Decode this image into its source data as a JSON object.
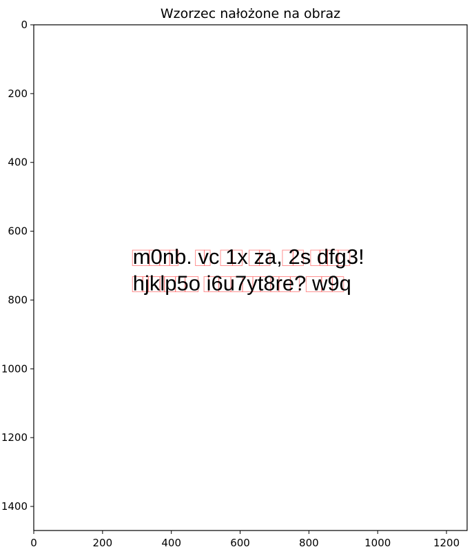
{
  "chart_data": {
    "type": "other",
    "title": "Wzorzec nałożone na obraz",
    "xlabel": "",
    "ylabel": "",
    "xlim": [
      0,
      1260
    ],
    "ylim": [
      1470,
      0
    ],
    "x_ticks": [
      0,
      200,
      400,
      600,
      800,
      1000,
      1200
    ],
    "y_ticks": [
      0,
      200,
      400,
      600,
      800,
      1000,
      1200,
      1400
    ],
    "grid": false,
    "text_lines": [
      "m0nb. vc 1x za, 2s dfg3!",
      "hjklp5o i6u7yt8re? w9q"
    ],
    "text_start_x": 288,
    "text_line_baselines_y": [
      695,
      772
    ],
    "glyph_boxes": [
      {
        "line": 0,
        "x0": 287,
        "x1": 336
      },
      {
        "line": 0,
        "x0": 336,
        "x1": 366
      },
      {
        "line": 0,
        "x0": 366,
        "x1": 395
      },
      {
        "line": 0,
        "x0": 395,
        "x1": 420
      },
      {
        "line": 0,
        "x0": 470,
        "x1": 496
      },
      {
        "line": 0,
        "x0": 496,
        "x1": 513
      },
      {
        "line": 0,
        "x0": 543,
        "x1": 578
      },
      {
        "line": 0,
        "x0": 578,
        "x1": 606
      },
      {
        "line": 0,
        "x0": 626,
        "x1": 656
      },
      {
        "line": 0,
        "x0": 656,
        "x1": 687
      },
      {
        "line": 0,
        "x0": 723,
        "x1": 754
      },
      {
        "line": 0,
        "x0": 754,
        "x1": 784
      },
      {
        "line": 0,
        "x0": 805,
        "x1": 832
      },
      {
        "line": 0,
        "x0": 832,
        "x1": 854
      },
      {
        "line": 0,
        "x0": 854,
        "x1": 885
      },
      {
        "line": 0,
        "x0": 885,
        "x1": 919
      },
      {
        "line": 1,
        "x0": 287,
        "x1": 317
      },
      {
        "line": 1,
        "x0": 317,
        "x1": 333
      },
      {
        "line": 1,
        "x0": 333,
        "x1": 367
      },
      {
        "line": 1,
        "x0": 367,
        "x1": 380
      },
      {
        "line": 1,
        "x0": 380,
        "x1": 412
      },
      {
        "line": 1,
        "x0": 412,
        "x1": 440
      },
      {
        "line": 1,
        "x0": 440,
        "x1": 478
      },
      {
        "line": 1,
        "x0": 495,
        "x1": 508
      },
      {
        "line": 1,
        "x0": 508,
        "x1": 538
      },
      {
        "line": 1,
        "x0": 538,
        "x1": 573
      },
      {
        "line": 1,
        "x0": 573,
        "x1": 607
      },
      {
        "line": 1,
        "x0": 607,
        "x1": 637
      },
      {
        "line": 1,
        "x0": 637,
        "x1": 659
      },
      {
        "line": 1,
        "x0": 659,
        "x1": 689
      },
      {
        "line": 1,
        "x0": 689,
        "x1": 713
      },
      {
        "line": 1,
        "x0": 713,
        "x1": 746
      },
      {
        "line": 1,
        "x0": 746,
        "x1": 772
      },
      {
        "line": 1,
        "x0": 792,
        "x1": 837
      },
      {
        "line": 1,
        "x0": 837,
        "x1": 868
      },
      {
        "line": 1,
        "x0": 868,
        "x1": 901
      }
    ]
  }
}
